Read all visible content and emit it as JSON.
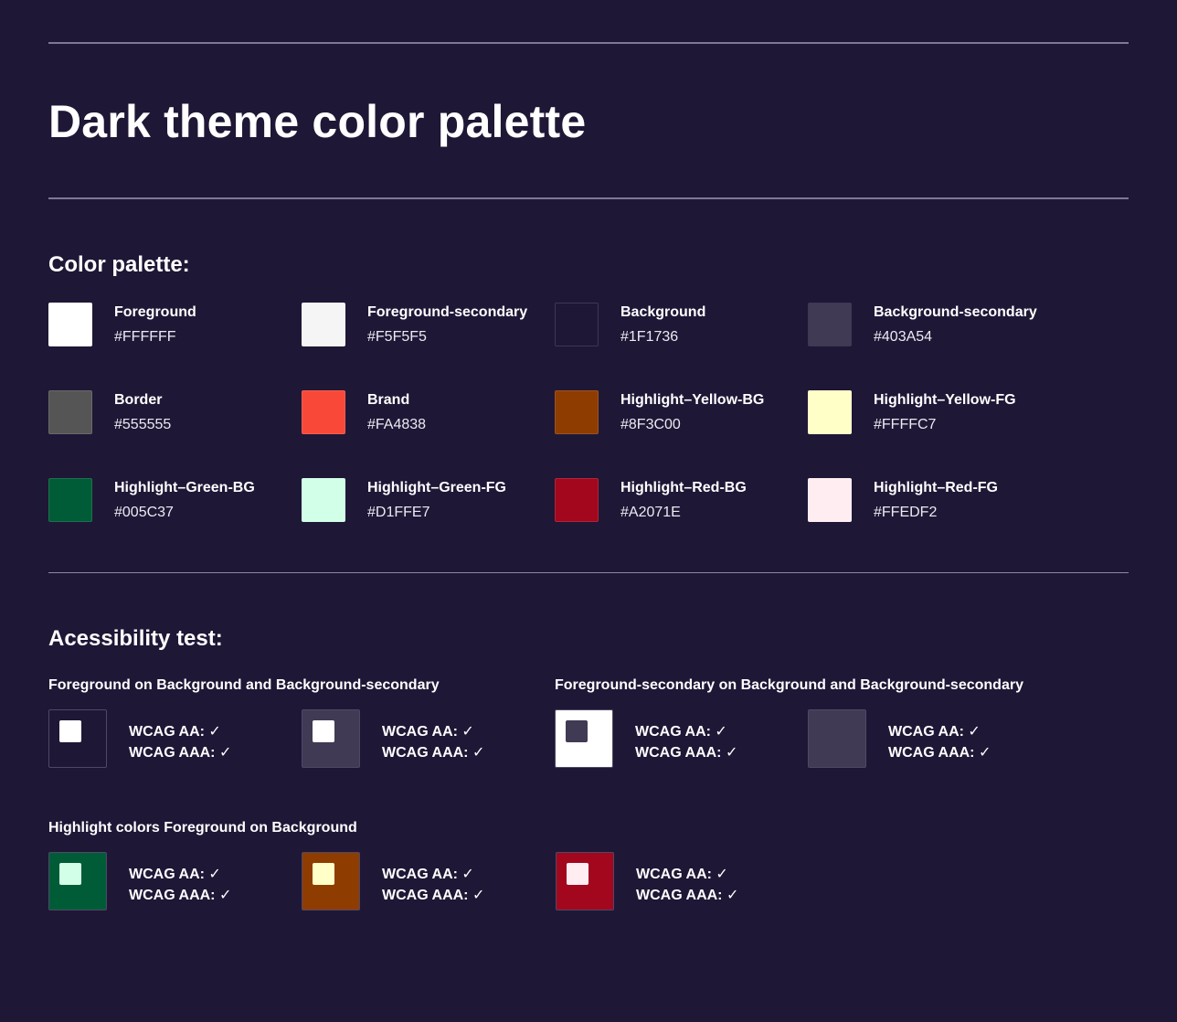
{
  "page": {
    "title": "Dark theme color palette"
  },
  "palette": {
    "title": "Color palette:",
    "colors": [
      {
        "name": "Foreground",
        "hex": "#FFFFFF",
        "color": "#FFFFFF"
      },
      {
        "name": "Foreground-secondary",
        "hex": "#F5F5F5",
        "color": "#F5F5F5"
      },
      {
        "name": "Background",
        "hex": "#1F1736",
        "color": "#1F1736"
      },
      {
        "name": "Background-secondary",
        "hex": "#403A54",
        "color": "#403A54"
      },
      {
        "name": "Border",
        "hex": "#555555",
        "color": "#555555"
      },
      {
        "name": "Brand",
        "hex": "#FA4838",
        "color": "#FA4838"
      },
      {
        "name": "Highlight–Yellow-BG",
        "hex": "#8F3C00",
        "color": "#8F3C00"
      },
      {
        "name": "Highlight–Yellow-FG",
        "hex": "#FFFFC7",
        "color": "#FFFFC7"
      },
      {
        "name": "Highlight–Green-BG",
        "hex": "#005C37",
        "color": "#005C37"
      },
      {
        "name": "Highlight–Green-FG",
        "hex": "#D1FFE7",
        "color": "#D1FFE7"
      },
      {
        "name": "Highlight–Red-BG",
        "hex": "#A2071E",
        "color": "#A2071E"
      },
      {
        "name": "Highlight–Red-FG",
        "hex": "#FFEDF2",
        "color": "#FFEDF2"
      }
    ]
  },
  "accessibility": {
    "title": "Acessibility test:",
    "groups": [
      {
        "title": "Foreground on Background and Background-secondary"
      },
      {
        "title": "Foreground-secondary on Background and Background-secondary"
      },
      {
        "title": "Highlight colors Foreground on Background"
      }
    ],
    "tests": [
      {
        "bg": "#1F1736",
        "fg": "#FFFFFF",
        "aa": "WCAG AA: ✓",
        "aaa": "WCAG AAA: ✓"
      },
      {
        "bg": "#403A54",
        "fg": "#FFFFFF",
        "aa": "WCAG AA: ✓",
        "aaa": "WCAG AAA: ✓"
      },
      {
        "bg": "#FFFFFF",
        "fg": "#403A54",
        "aa": "WCAG AA: ✓",
        "aaa": "WCAG AAA: ✓"
      },
      {
        "bg": "#403A54",
        "fg": "#403A54",
        "aa": "WCAG AA: ✓",
        "aaa": "WCAG AAA: ✓"
      },
      {
        "bg": "#005C37",
        "fg": "#D1FFE7",
        "aa": "WCAG AA: ✓",
        "aaa": "WCAG AAA: ✓"
      },
      {
        "bg": "#8F3C00",
        "fg": "#FFFFC7",
        "aa": "WCAG AA: ✓",
        "aaa": "WCAG AAA: ✓"
      },
      {
        "bg": "#A2071E",
        "fg": "#FFEDF2",
        "aa": "WCAG AA: ✓",
        "aaa": "WCAG AAA: ✓"
      }
    ]
  }
}
